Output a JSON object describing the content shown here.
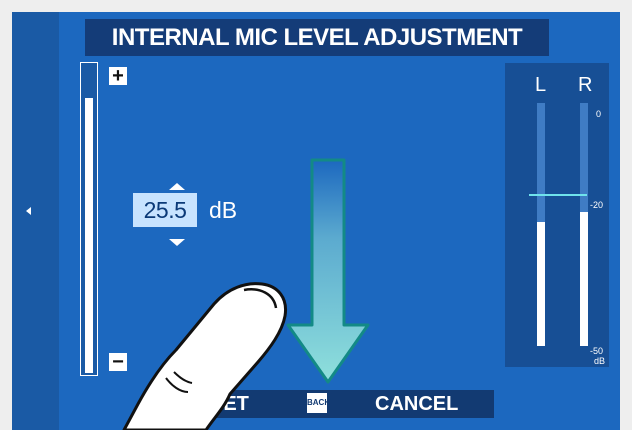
{
  "title": "INTERNAL MIC LEVEL ADJUSTMENT",
  "level": {
    "value": "25.5",
    "unit": "dB",
    "slider_fraction": 0.88
  },
  "meter": {
    "left_label": "L",
    "right_label": "R",
    "scale_top": "0",
    "scale_mid": "-20",
    "scale_bottom": "-50",
    "scale_unit": "dB",
    "left_level_fraction": 0.51,
    "right_level_fraction": 0.55
  },
  "footer": {
    "set_label": "SET",
    "back_icon_text": "BACK",
    "cancel_label": "CANCEL"
  },
  "colors": {
    "screen_bg": "#1c68bf",
    "title_bg": "#143c78",
    "value_box_bg": "#c7e3ff",
    "reference_line": "#6fe3ec",
    "arrow": "#8fe0dc"
  },
  "icons": {
    "plus": "+",
    "minus": "−",
    "increase": "triangle-up",
    "decrease": "triangle-down",
    "gesture": "finger-swipe-down"
  }
}
